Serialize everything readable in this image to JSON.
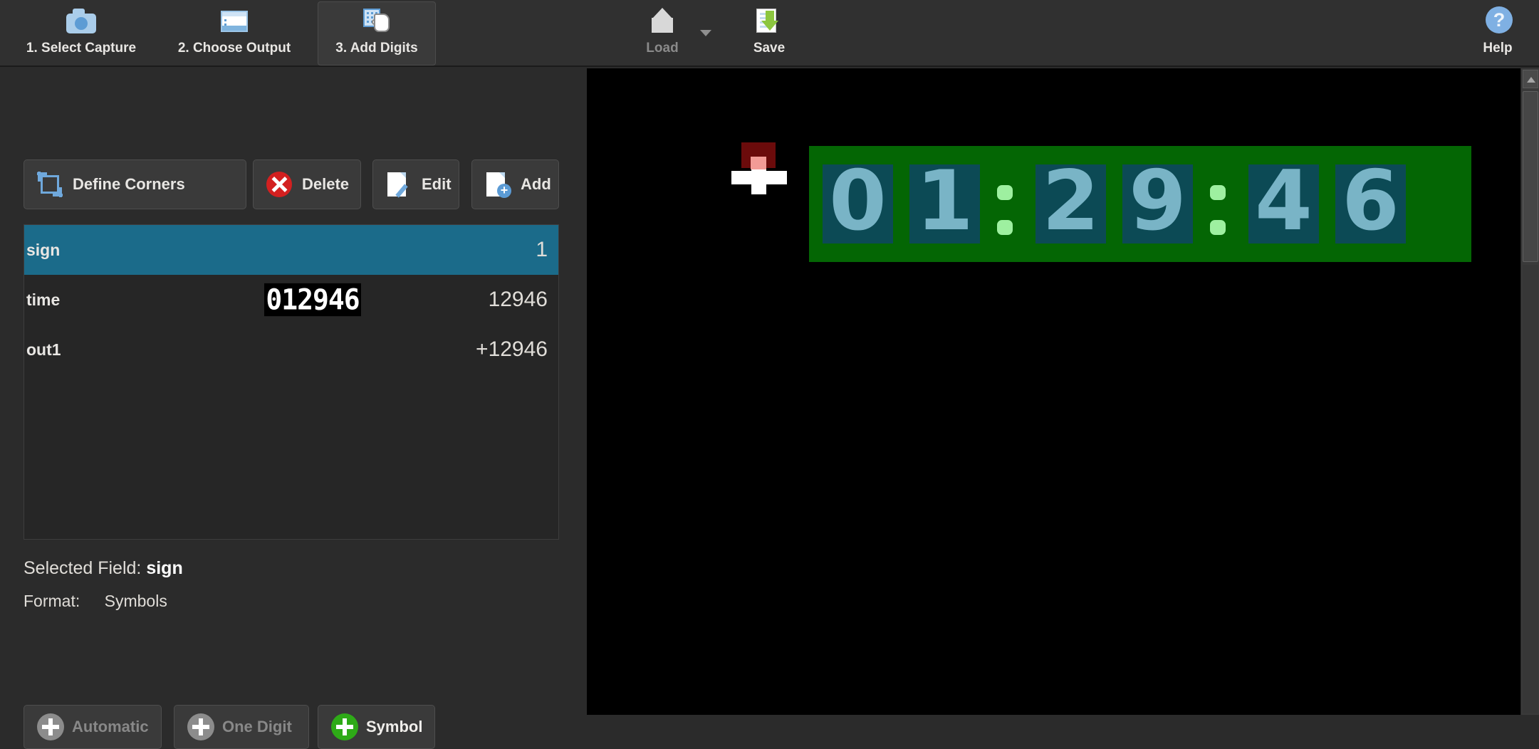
{
  "ribbon": {
    "steps": [
      {
        "label": "1. Select Capture",
        "icon": "camera-icon",
        "active": false
      },
      {
        "label": "2. Choose Output",
        "icon": "window-icon",
        "active": false
      },
      {
        "label": "3. Add Digits",
        "icon": "digits-hand-icon",
        "active": true
      }
    ],
    "load": {
      "label": "Load",
      "icon": "load-icon",
      "enabled": false
    },
    "save": {
      "label": "Save",
      "icon": "save-icon",
      "enabled": true
    },
    "help": {
      "label": "Help",
      "icon": "help-icon",
      "glyph": "?"
    }
  },
  "actions": [
    {
      "label": "Define Corners",
      "icon": "crop-corners-icon"
    },
    {
      "label": "Delete",
      "icon": "delete-circle-icon"
    },
    {
      "label": "Edit",
      "icon": "document-edit-icon"
    },
    {
      "label": "Add",
      "icon": "document-add-icon"
    }
  ],
  "fields": {
    "columns": [
      "name",
      "preview",
      "value"
    ],
    "rows": [
      {
        "name": "sign",
        "preview": "",
        "value": "1",
        "selected": true
      },
      {
        "name": "time",
        "preview": "012946",
        "value": "12946",
        "selected": false
      },
      {
        "name": "out1",
        "preview": "",
        "value": "+12946",
        "selected": false
      }
    ]
  },
  "info": {
    "selected_field_label": "Selected Field:",
    "selected_field_value": "sign",
    "format_label": "Format:",
    "format_value": "Symbols"
  },
  "add_buttons": [
    {
      "label": "Automatic",
      "icon": "plus-icon",
      "enabled": false
    },
    {
      "label": "One Digit",
      "icon": "plus-icon",
      "enabled": false
    },
    {
      "label": "Symbol",
      "icon": "plus-icon",
      "enabled": true
    }
  ],
  "canvas": {
    "background_color": "#000000",
    "display": {
      "panel_color": "#046604",
      "cell_color": "#0c4a55",
      "digit_color": "#79b4c6",
      "colon_color": "#9ef0a0",
      "digits": [
        "0",
        "1",
        "2",
        "9",
        "4",
        "6"
      ],
      "separators": [
        ":",
        ":"
      ],
      "reading": "01:29:46"
    },
    "sign_marker": {
      "symbol": "+",
      "highlight_color": "#6b0b0b",
      "symbol_color": "#ffffff"
    }
  },
  "colors": {
    "window_bg": "#2b2b2b",
    "ribbon_bg": "#303030",
    "selection_blue": "#1b6b8a",
    "accent_green": "#2eaa17",
    "accent_red": "#d32020",
    "accent_blue": "#6fa8dc"
  }
}
